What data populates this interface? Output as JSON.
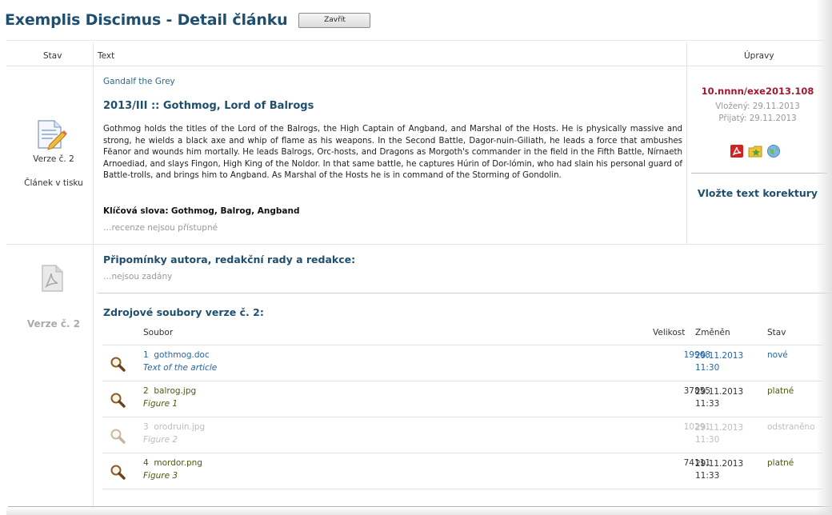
{
  "header": {
    "title": "Exemplis Discimus - Detail článku",
    "close_label": "Zavřít"
  },
  "columns": {
    "status": "Stav",
    "text": "Text",
    "edits": "Úpravy"
  },
  "version_block": {
    "version_label": "Verze č. 2",
    "state_label": "Článek v tisku"
  },
  "article": {
    "author": "Gandalf the Grey",
    "title": "2013/III :: Gothmog, Lord of Balrogs",
    "abstract": "Gothmog holds the titles of the Lord of the Balrogs, the High Captain of Angband, and Marshal of the Hosts. He is physically massive and strong, he wields a black axe and whip of flame as his weapons. In the Second Battle, Dagor-nuin-Giliath, he leads a force that ambushes Fëanor and wounds him mortally. He leads Balrogs, Orc-hosts, and Dragons as Morgoth's commander in the field in the Fifth Battle, Nírnaeth Arnoediad, and slays Fingon, High King of the Noldor. In that same battle, he captures Húrin of Dor-lómin, who had slain his personal guard of Battle-trolls, and brings him to Angband. As Marshal of the Hosts he is in command of the Storming of Gondolin.",
    "keywords_label": "Klíčová slova:",
    "keywords": "Gothmog, Balrog, Angband",
    "reviews": "…recenze nejsou přístupné"
  },
  "edits": {
    "doi": "10.nnnn/exe2013.108",
    "inserted": "Vložený: 29.11.2013",
    "accepted": "Přijatý: 29.11.2013",
    "icons": [
      "pdf-icon",
      "star-folder-icon",
      "globe-icon"
    ],
    "proof_link": "Vložte text korektury"
  },
  "comments": {
    "title": "Připomínky autora, redakční rady a redakce:",
    "empty": "…nejsou zadány"
  },
  "sources": {
    "version_label": "Verze č. 2",
    "title": "Zdrojové soubory verze č. 2:",
    "headers": {
      "file": "Soubor",
      "size": "Velikost",
      "changed": "Změněn",
      "state": "Stav"
    },
    "files": [
      {
        "num": "1",
        "name": "gothmog.doc",
        "desc": "Text of the article",
        "size": "19968",
        "date": "29.11.2013",
        "time": "11:30",
        "state": "nové"
      },
      {
        "num": "2",
        "name": "balrog.jpg",
        "desc": "Figure 1",
        "size": "37855",
        "date": "29.11.2013",
        "time": "11:33",
        "state": "platné"
      },
      {
        "num": "3",
        "name": "orodruin.jpg",
        "desc": "Figure 2",
        "size": "10291",
        "date": "29.11.2013",
        "time": "11:30",
        "state": "odstraněno"
      },
      {
        "num": "4",
        "name": "mordor.png",
        "desc": "Figure 3",
        "size": "74111",
        "date": "29.11.2013",
        "time": "11:33",
        "state": "platné"
      }
    ]
  },
  "colors": {
    "heading": "#1f4f6e",
    "doi": "#9b1b30",
    "link_blue": "#2466a8",
    "olive": "#4a5a12"
  }
}
